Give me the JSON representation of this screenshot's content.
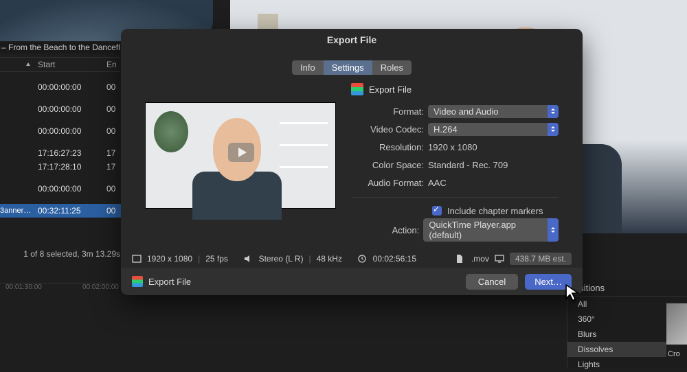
{
  "project": {
    "title": "– From the Beach to the Dancefloor"
  },
  "table": {
    "headers": {
      "start": "Start",
      "end": "En"
    },
    "rows": [
      {
        "start": "00:00:00:00",
        "end": "00"
      },
      {
        "start": "00:00:00:00",
        "end": "00"
      },
      {
        "start": "00:00:00:00",
        "end": "00"
      },
      {
        "start": "17:16:27:23",
        "end": "17"
      },
      {
        "start": "17:17:28:10",
        "end": "17"
      },
      {
        "start": "00:00:00:00",
        "end": "00"
      },
      {
        "name": "3anner…",
        "start": "00:32:11:25",
        "end": "00"
      }
    ],
    "status": "1 of 8 selected, 3m 13.29s"
  },
  "ruler": {
    "t1": "00:01:30:00",
    "t2": "00:02:00:00"
  },
  "transitions": {
    "header": "nsitions",
    "items": [
      "All",
      "360°",
      "Blurs",
      "Dissolves",
      "Lights"
    ],
    "selectedIndex": 3,
    "thumb": "Cro"
  },
  "modal": {
    "title": "Export File",
    "tabs": {
      "info": "Info",
      "settings": "Settings",
      "roles": "Roles"
    },
    "share_label": "Export File",
    "form": {
      "format_lbl": "Format:",
      "format_val": "Video and Audio",
      "codec_lbl": "Video Codec:",
      "codec_val": "H.264",
      "res_lbl": "Resolution:",
      "res_val": "1920 x 1080",
      "cspace_lbl": "Color Space:",
      "cspace_val": "Standard - Rec. 709",
      "audio_lbl": "Audio Format:",
      "audio_val": "AAC",
      "chapter": "Include chapter markers",
      "action_lbl": "Action:",
      "action_val": "QuickTime Player.app (default)"
    },
    "info_bar": {
      "res": "1920 x 1080",
      "fps": "25 fps",
      "audio": "Stereo (L R)",
      "khz": "48 kHz",
      "duration": "00:02:56:15",
      "ext": ".mov",
      "size": "438.7 MB est."
    },
    "footer": {
      "label": "Export File",
      "cancel": "Cancel",
      "next": "Next…"
    }
  }
}
